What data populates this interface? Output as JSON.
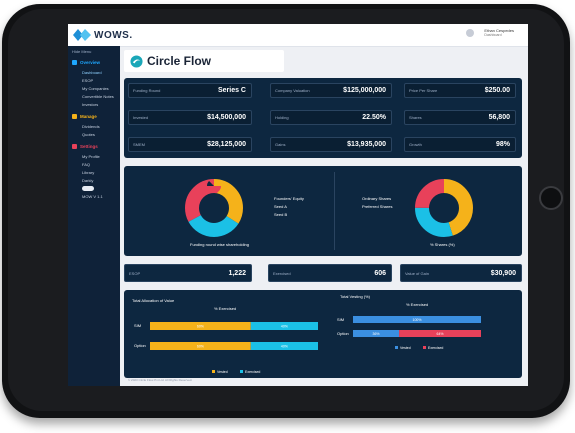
{
  "brand": {
    "name": "WOWS."
  },
  "user": {
    "name": "Ethan Cespedes",
    "role": "Dashboard"
  },
  "sidebar": {
    "top_item": "Hide Menu",
    "sections": [
      {
        "label": "Overview",
        "color": "#1ea7ff",
        "items": [
          "Dashboard",
          "ESOP",
          "My Companies",
          "Convertible Notes",
          "Investors"
        ]
      },
      {
        "label": "Manage",
        "color": "#f5b21a",
        "items": [
          "Dividends",
          "Quotes"
        ]
      },
      {
        "label": "Settings",
        "color": "#e8415a",
        "items": [
          "My Profile",
          "FAQ",
          "Library",
          "Darkly"
        ]
      }
    ],
    "version": "MOW V 1.1"
  },
  "header": {
    "title": "Circle Flow"
  },
  "stats": [
    {
      "label": "Funding Round",
      "value": "Series C"
    },
    {
      "label": "Company Valuation",
      "value": "$125,000,000"
    },
    {
      "label": "Price Per Share",
      "value": "$250.00"
    },
    {
      "label": "Invested",
      "value": "$14,500,000"
    },
    {
      "label": "Holding",
      "value": "22.50%"
    },
    {
      "label": "Shares",
      "value": "56,800"
    },
    {
      "label": "SMEM",
      "value": "$28,125,000"
    },
    {
      "label": "Gains",
      "value": "$13,935,000"
    },
    {
      "label": "Growth",
      "value": "98%"
    }
  ],
  "pie_left": {
    "legend": [
      "Founders' Equity",
      "Seed A",
      "Seed B"
    ],
    "caption": "Funding round wise shareholding",
    "colors": [
      "#f5b21a",
      "#1bc0e6",
      "#e8415a"
    ],
    "values": [
      34,
      33,
      33
    ]
  },
  "pie_right": {
    "legend": [
      "Ordinary Shares",
      "Preferred Shares"
    ],
    "caption": "% Shares (%)",
    "colors": [
      "#f5b21a",
      "#1bc0e6",
      "#e8415a"
    ],
    "values": [
      45,
      30,
      25
    ]
  },
  "esop": [
    {
      "label": "ESOP",
      "value": "1,222"
    },
    {
      "label": "Exercised",
      "value": "606"
    },
    {
      "label": "Value of Gain",
      "value": "$30,900"
    }
  ],
  "chart_data": [
    {
      "type": "bar",
      "title": "Total Allocation of Value",
      "subtitle": "% Exercised",
      "categories": [
        "SIM",
        "Option"
      ],
      "series": [
        {
          "name": "Vested",
          "color": "#f5b21a",
          "values": [
            60,
            60
          ]
        },
        {
          "name": "Exercised",
          "color": "#1bc0e6",
          "values": [
            40,
            40
          ]
        }
      ],
      "bar_labels": [
        [
          "60%",
          "40%"
        ],
        [
          "60%",
          "40%"
        ]
      ],
      "legend": [
        "Vested",
        "Exercised"
      ]
    },
    {
      "type": "bar",
      "title": "Total Vesting (%)",
      "subtitle": "% Exercised",
      "categories": [
        "SIM",
        "Option"
      ],
      "series": [
        {
          "name": "Vested",
          "color": "#3b8fe0",
          "values": [
            100,
            36
          ]
        },
        {
          "name": "Exercised",
          "color": "#e8415a",
          "values": [
            0,
            64
          ]
        }
      ],
      "bar_labels": [
        [
          "100%",
          ""
        ],
        [
          "36%",
          "64%"
        ]
      ],
      "legend": [
        "Vested",
        "Exercised"
      ]
    }
  ],
  "footer": "© 2023 Circle Flow Pvt Ltd. All Rights Reserved."
}
